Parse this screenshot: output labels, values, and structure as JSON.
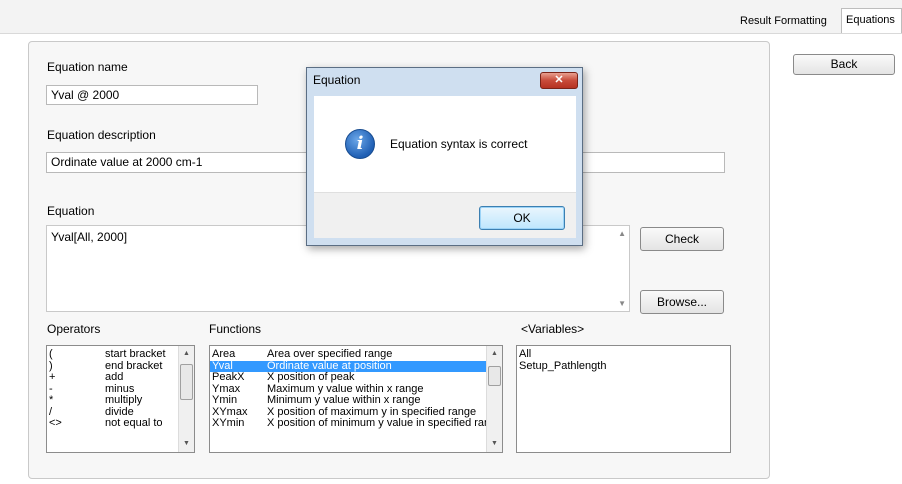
{
  "tabs": [
    {
      "label": "Result Formatting",
      "active": false
    },
    {
      "label": "Equations",
      "active": true
    }
  ],
  "form": {
    "name_label": "Equation name",
    "name_value": "Yval @ 2000",
    "description_label": "Equation description",
    "description_value": "Ordinate value at 2000 cm-1",
    "equation_label": "Equation",
    "equation_value": "Yval[All, 2000]",
    "check_label": "Check",
    "browse_label": "Browse...",
    "back_label": "Back"
  },
  "operators": {
    "label": "Operators",
    "items": [
      {
        "symbol": "(",
        "desc": "start bracket"
      },
      {
        "symbol": ")",
        "desc": "end bracket"
      },
      {
        "symbol": "+",
        "desc": "add"
      },
      {
        "symbol": "-",
        "desc": "minus"
      },
      {
        "symbol": "*",
        "desc": "multiply"
      },
      {
        "symbol": "/",
        "desc": "divide"
      },
      {
        "symbol": "<>",
        "desc": "not equal to"
      }
    ]
  },
  "functions": {
    "label": "Functions",
    "items": [
      {
        "name": "Area",
        "desc": "Area over specified range",
        "selected": false
      },
      {
        "name": "Yval",
        "desc": "Ordinate value at position",
        "selected": true
      },
      {
        "name": "PeakX",
        "desc": "X position of peak",
        "selected": false
      },
      {
        "name": "Ymax",
        "desc": "Maximum y value within x range",
        "selected": false
      },
      {
        "name": "Ymin",
        "desc": "Minimum y value within x range",
        "selected": false
      },
      {
        "name": "XYmax",
        "desc": "X position of maximum y in specified range",
        "selected": false
      },
      {
        "name": "XYmin",
        "desc": "X position of minimum y value in specified range",
        "selected": false
      }
    ]
  },
  "variables": {
    "label": "<Variables>",
    "items": [
      "All",
      "Setup_Pathlength"
    ]
  },
  "dialog": {
    "title": "Equation",
    "message": "Equation syntax is correct",
    "ok_label": "OK",
    "close_glyph": "✕",
    "icon": "information-icon"
  },
  "colors": {
    "selection": "#3399ff",
    "dialog_frame": "#cfdff0"
  }
}
